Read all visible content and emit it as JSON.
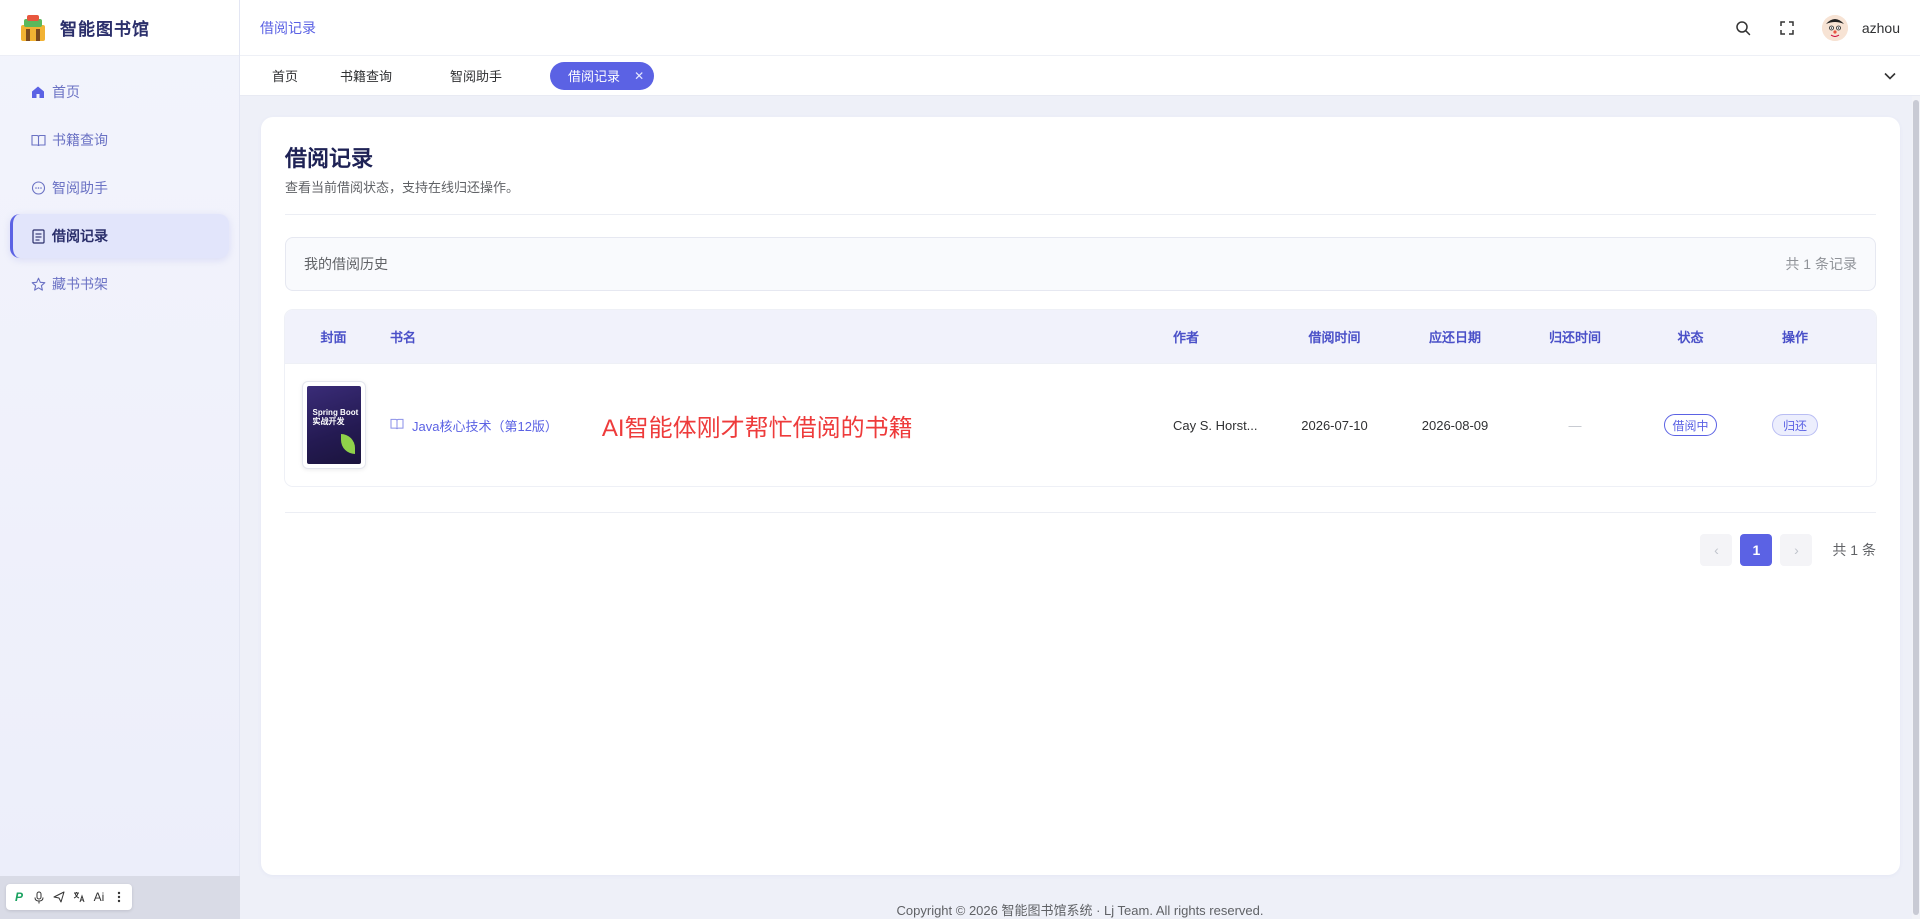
{
  "brand": {
    "title": "智能图书馆"
  },
  "sidebar": {
    "items": [
      {
        "label": "首页",
        "icon": "home-icon"
      },
      {
        "label": "书籍查询",
        "icon": "book-icon"
      },
      {
        "label": "智阅助手",
        "icon": "chat-icon"
      },
      {
        "label": "借阅记录",
        "icon": "document-icon",
        "active": true
      },
      {
        "label": "藏书书架",
        "icon": "star-icon"
      }
    ]
  },
  "header": {
    "breadcrumb": "借阅记录",
    "username": "azhou"
  },
  "tags": [
    {
      "label": "首页"
    },
    {
      "label": "书籍查询"
    },
    {
      "label": "智阅助手"
    },
    {
      "label": "借阅记录",
      "active": true
    }
  ],
  "page": {
    "title": "借阅记录",
    "subtitle": "查看当前借阅状态，支持在线归还操作。"
  },
  "section": {
    "label": "我的借阅历史",
    "count": "共 1 条记录"
  },
  "table": {
    "columns": [
      "封面",
      "书名",
      "作者",
      "借阅时间",
      "应还日期",
      "归还时间",
      "状态",
      "操作"
    ],
    "rows": [
      {
        "cover_text": "Spring Boot 实战开发",
        "title": "Java核心技术（第12版）",
        "author": "Cay S. Horst...",
        "borrow_date": "2026-07-10",
        "due_date": "2026-08-09",
        "return_date": "—",
        "status": "借阅中",
        "action": "归还"
      }
    ]
  },
  "annotation": "AI智能体刚才帮忙借阅的书籍",
  "pagination": {
    "prev": "‹",
    "current": "1",
    "next": "›",
    "total": "共 1 条"
  },
  "footer": "Copyright © 2026 智能图书馆系统 · Lj Team. All rights reserved.",
  "float_toolbar": {
    "items": [
      "P",
      "mic-icon",
      "send-icon",
      "translate-icon",
      "Ai"
    ]
  },
  "colors": {
    "accent": "#5b62e4",
    "annotation": "#ee3b3b"
  }
}
